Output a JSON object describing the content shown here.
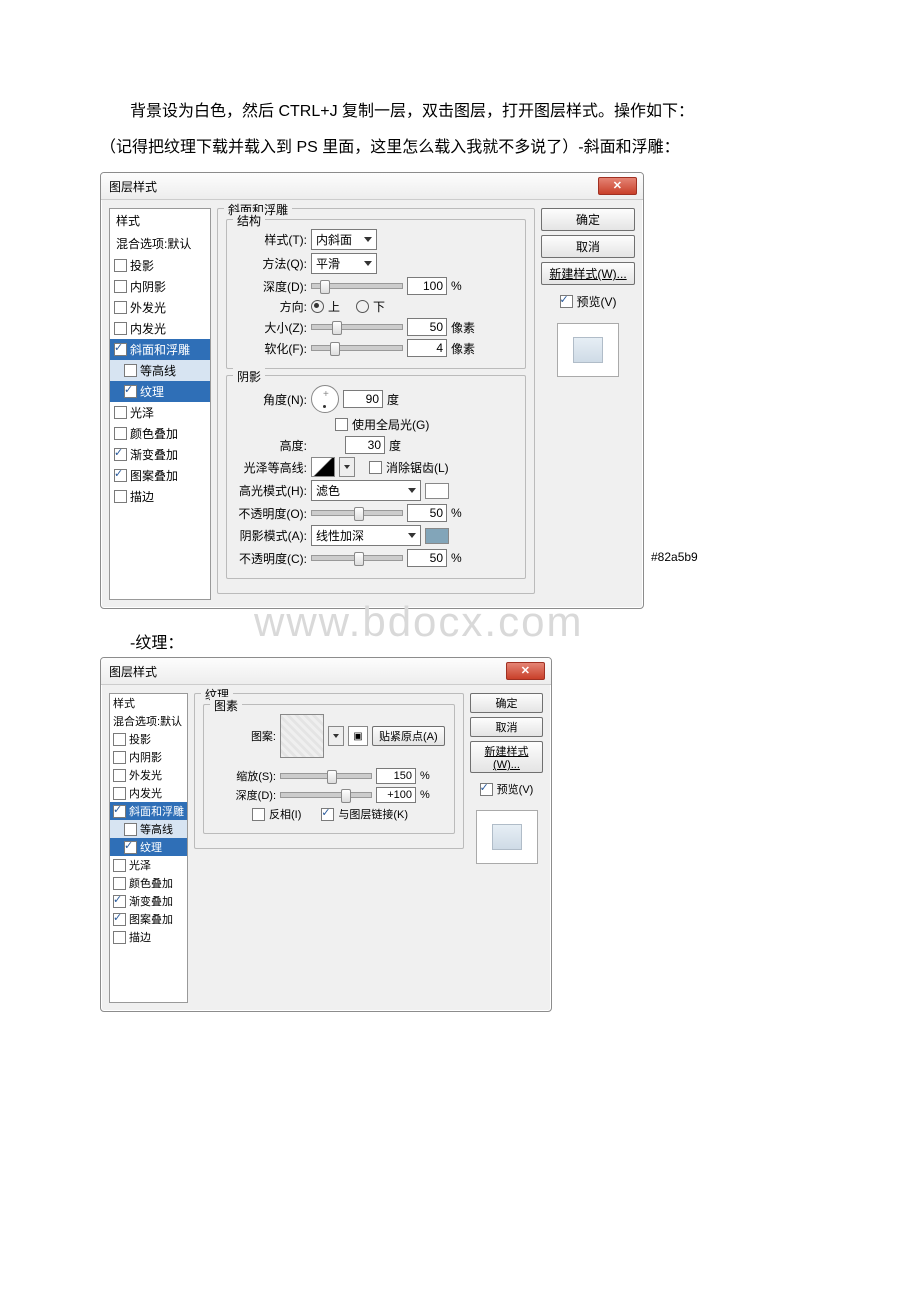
{
  "intro_line1": "背景设为白色，然后 CTRL+J 复制一层，双击图层，打开图层样式。操作如下：",
  "intro_line2": "（记得把纹理下载并载入到 PS 里面，这里怎么载入我就不多说了）-斜面和浮雕：",
  "section2_label": "-纹理：",
  "watermark": "www.bdocx.com",
  "annotation_color": "#82a5b9",
  "dialog": {
    "title": "图层样式",
    "close": "✕",
    "ok": "确定",
    "cancel": "取消",
    "new_style": "新建样式(W)...",
    "preview": "预览(V)"
  },
  "sidebar": {
    "head": "样式",
    "default": "混合选项:默认",
    "items": [
      {
        "label": "投影",
        "checked": false
      },
      {
        "label": "内阴影",
        "checked": false
      },
      {
        "label": "外发光",
        "checked": false
      },
      {
        "label": "内发光",
        "checked": false
      },
      {
        "label": "斜面和浮雕",
        "checked": true,
        "selected": true
      },
      {
        "label": "等高线",
        "checked": false,
        "sub": true,
        "sel_sub": true
      },
      {
        "label": "纹理",
        "checked": true,
        "sub": true,
        "sel_sub": true
      },
      {
        "label": "光泽",
        "checked": false
      },
      {
        "label": "颜色叠加",
        "checked": false
      },
      {
        "label": "渐变叠加",
        "checked": true
      },
      {
        "label": "图案叠加",
        "checked": true
      },
      {
        "label": "描边",
        "checked": false
      }
    ]
  },
  "bevel": {
    "group_title": "斜面和浮雕",
    "struct_title": "结构",
    "style_lbl": "样式(T):",
    "style_val": "内斜面",
    "tech_lbl": "方法(Q):",
    "tech_val": "平滑",
    "depth_lbl": "深度(D):",
    "depth_val": "100",
    "pct": "%",
    "dir_lbl": "方向:",
    "dir_up": "上",
    "dir_down": "下",
    "size_lbl": "大小(Z):",
    "size_val": "50",
    "px": "像素",
    "soften_lbl": "软化(F):",
    "soften_val": "4",
    "shade_title": "阴影",
    "angle_lbl": "角度(N):",
    "angle_val": "90",
    "deg": "度",
    "global": "使用全局光(G)",
    "alt_lbl": "高度:",
    "alt_val": "30",
    "gloss_lbl": "光泽等高线:",
    "antialias": "消除锯齿(L)",
    "hi_mode_lbl": "高光模式(H):",
    "hi_mode_val": "滤色",
    "hi_op_lbl": "不透明度(O):",
    "hi_op_val": "50",
    "sh_mode_lbl": "阴影模式(A):",
    "sh_mode_val": "线性加深",
    "sh_op_lbl": "不透明度(C):",
    "sh_op_val": "50"
  },
  "texture": {
    "group_title": "纹理",
    "elem_title": "图素",
    "pattern_lbl": "图案:",
    "snap": "贴紧原点(A)",
    "scale_lbl": "缩放(S):",
    "scale_val": "150",
    "depth_lbl": "深度(D):",
    "depth_val": "+100",
    "pct": "%",
    "invert": "反相(I)",
    "link": "与图层链接(K)"
  }
}
